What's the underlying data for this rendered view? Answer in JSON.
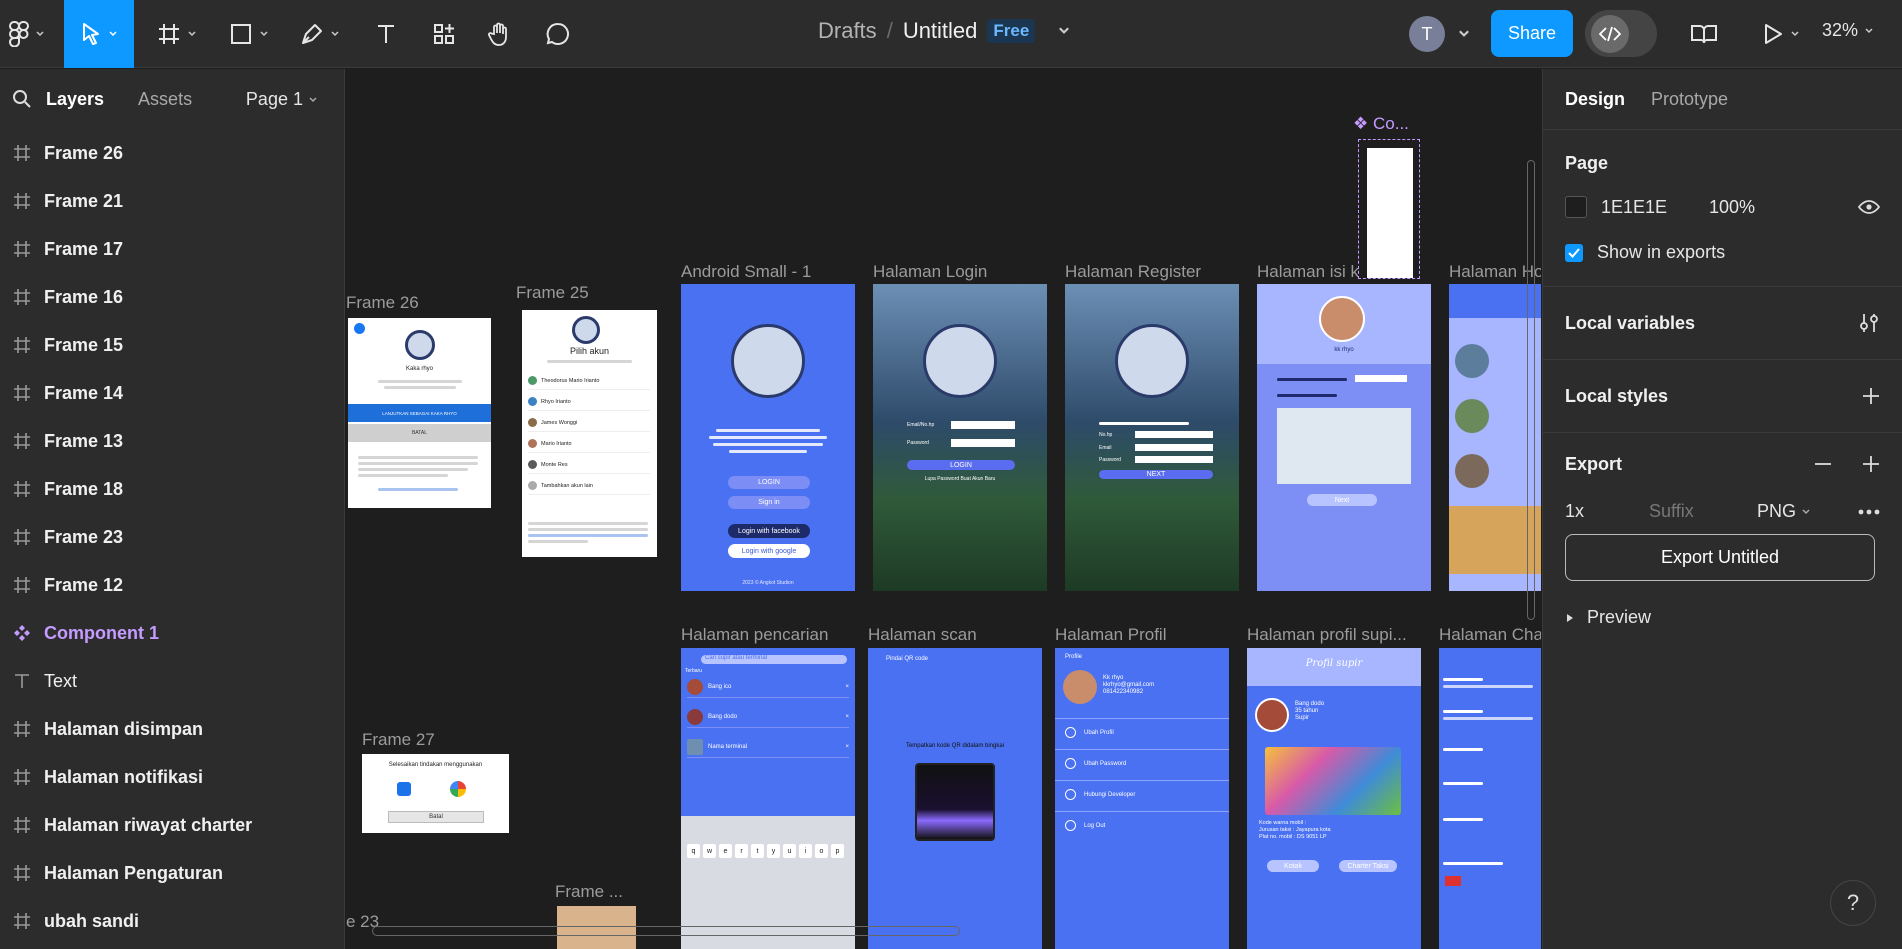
{
  "toolbar": {
    "breadcrumb_parent": "Drafts",
    "separator": "/",
    "file_name": "Untitled",
    "plan_badge": "Free",
    "avatar_initial": "T",
    "share_label": "Share",
    "zoom_level": "32%"
  },
  "left_panel": {
    "tabs": [
      "Layers",
      "Assets"
    ],
    "page_selector": "Page 1",
    "layers": [
      {
        "name": "Frame 26",
        "type": "frame"
      },
      {
        "name": "Frame 21",
        "type": "frame"
      },
      {
        "name": "Frame 17",
        "type": "frame"
      },
      {
        "name": "Frame 16",
        "type": "frame"
      },
      {
        "name": "Frame 15",
        "type": "frame"
      },
      {
        "name": "Frame 14",
        "type": "frame"
      },
      {
        "name": "Frame 13",
        "type": "frame"
      },
      {
        "name": "Frame 18",
        "type": "frame"
      },
      {
        "name": "Frame 23",
        "type": "frame"
      },
      {
        "name": "Frame 12",
        "type": "frame"
      },
      {
        "name": "Component 1",
        "type": "component"
      },
      {
        "name": "Text",
        "type": "text"
      },
      {
        "name": "Halaman disimpan",
        "type": "frame"
      },
      {
        "name": "Halaman notifikasi",
        "type": "frame"
      },
      {
        "name": "Halaman riwayat charter",
        "type": "frame"
      },
      {
        "name": "Halaman Pengaturan",
        "type": "frame"
      },
      {
        "name": "ubah sandi",
        "type": "frame"
      }
    ]
  },
  "canvas": {
    "frame_labels": {
      "f26": "Frame 26",
      "f25": "Frame 25",
      "android": "Android Small - 1",
      "login": "Halaman Login",
      "register": "Halaman Register",
      "isi": "Halaman isi k... l",
      "ho": "Halaman Ho",
      "component": "Co...",
      "pencarian": "Halaman pencarian",
      "scan": "Halaman scan",
      "profil": "Halaman Profil",
      "profil_supir": "Halaman profil supi...",
      "cha": "Halaman Cha",
      "f27": "Frame 27",
      "frame_dots": "Frame ...",
      "e23": "e 23"
    },
    "frame25": {
      "title": "Pilih akun",
      "contacts": [
        "Theodorus Mario Irianto",
        "Rhyo Irianto",
        "James Wonggi",
        "Mario Irianto",
        "Monte Res",
        "Tambahkan akun lain"
      ]
    },
    "frame26": {
      "name": "Kaka rhyo",
      "btn_continue": "LANJUTKAN SEBAGAI KAKA RHYO",
      "btn_cancel": "BATAL"
    },
    "android": {
      "buttons": [
        "LOGIN",
        "Sign in",
        "Login with facebook",
        "Login with google"
      ],
      "footer": "2023 © Angkot Studion"
    },
    "login": {
      "fields": [
        "Email/No.hp",
        "Password"
      ],
      "button": "LOGIN",
      "links": "Lupa Password  Buat Akun Baru"
    },
    "register": {
      "fields": [
        "No.hp",
        "Email",
        "Password"
      ],
      "button": "NEXT"
    },
    "isi": {
      "user": "kk rhyo",
      "button": "Next"
    },
    "pencarian": {
      "search_placeholder": "Cari supir atau terminal",
      "section": "Terbaru",
      "results": [
        "Bang ico",
        "Bang dodo",
        "Nama terminal"
      ],
      "keys": [
        "q",
        "w",
        "e",
        "r",
        "t",
        "y",
        "u",
        "i",
        "o",
        "p"
      ]
    },
    "scan": {
      "title": "Pindai QR code",
      "instruction": "Tempatkan kode QR didalam bingkai"
    },
    "profil": {
      "title": "Profile",
      "name": "Kk rhyo",
      "email": "kkrhyo@gmail.com",
      "phone": "081422340982",
      "menu": [
        "Ubah Profil",
        "Ubah Password",
        "Hubungi Developer",
        "Log Out"
      ]
    },
    "profil_supir": {
      "title": "Profil supir",
      "name": "Bang dodo",
      "age": "35 tahun",
      "role": "Supir",
      "info": [
        "Kode warna mobil :",
        "Jurusan taksi :  Jayapura kota",
        "Plat no. mobil :  DS 9051 LP"
      ],
      "buttons": [
        "Kotak",
        "Charter Taksi"
      ]
    },
    "frame27": {
      "title": "Selesaikan tindakan menggunakan",
      "cancel": "Batal"
    }
  },
  "right_panel": {
    "tabs": [
      "Design",
      "Prototype"
    ],
    "page_section": "Page",
    "page_color_hex": "1E1E1E",
    "page_opacity": "100%",
    "show_in_exports": "Show in exports",
    "local_variables": "Local variables",
    "local_styles": "Local styles",
    "export_title": "Export",
    "export_scale": "1x",
    "export_suffix_placeholder": "Suffix",
    "export_format": "PNG",
    "export_button": "Export Untitled",
    "preview": "Preview"
  },
  "help": "?",
  "colors": {
    "accent": "#0d99ff",
    "component": "#c49bff",
    "frame_blue": "#4a71f2"
  }
}
